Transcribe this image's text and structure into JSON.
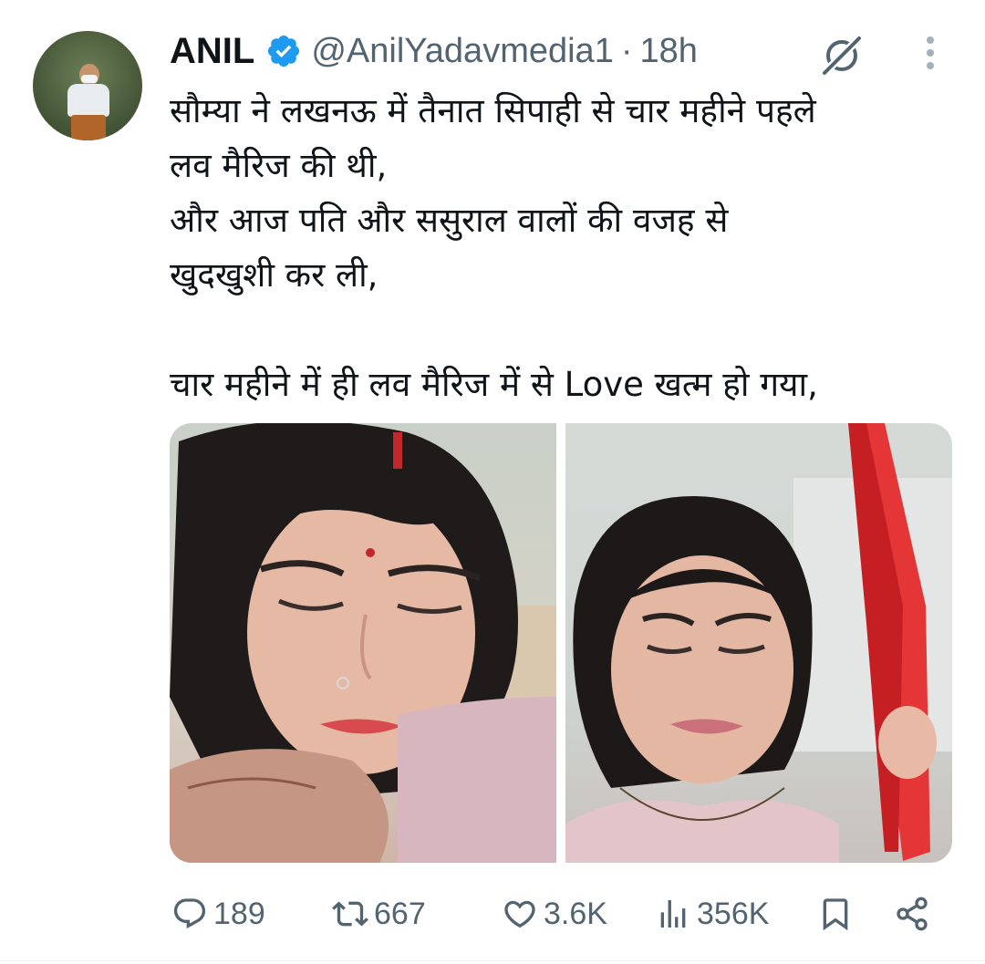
{
  "tweet": {
    "author_name": "ANIL",
    "author_handle": "@AnilYadavmedia1",
    "separator": "·",
    "time": "18h",
    "text": "सौम्या ने लखनऊ में तैनात सिपाही से चार महीने पहले\nलव मैरिज की थी,\nऔर आज पति और ससुराल वालों की वजह से\nखुदखुशी कर ली,\n\nचार महीने में ही लव मैरिज में से Love खत्म हो गया,"
  },
  "icons": {
    "verified": "verified-badge-icon",
    "grok": "grok-icon",
    "more": "more-vertical-icon",
    "reply": "reply-icon",
    "repost": "repost-icon",
    "like": "like-icon",
    "views": "views-icon",
    "bookmark": "bookmark-icon",
    "share": "share-icon"
  },
  "actions": {
    "replies": "189",
    "reposts": "667",
    "likes": "3.6K",
    "views": "356K"
  },
  "colors": {
    "text_primary": "#0f1419",
    "text_secondary": "#536471",
    "verified_blue": "#1d9bf0"
  }
}
